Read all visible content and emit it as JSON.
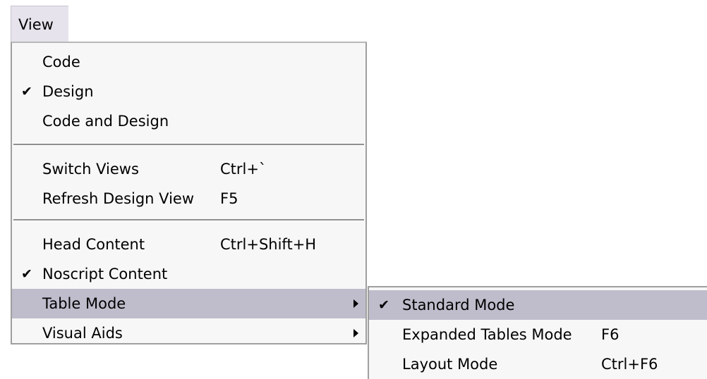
{
  "menubar": {
    "view_label": "View"
  },
  "view_menu": {
    "items": [
      {
        "label": "Code",
        "shortcut": "",
        "checked": false
      },
      {
        "label": "Design",
        "shortcut": "",
        "checked": true
      },
      {
        "label": "Code and Design",
        "shortcut": "",
        "checked": false
      },
      {
        "label": "Switch Views",
        "shortcut": "Ctrl+`",
        "checked": false
      },
      {
        "label": "Refresh Design View",
        "shortcut": "F5",
        "checked": false
      },
      {
        "label": "Head Content",
        "shortcut": "Ctrl+Shift+H",
        "checked": false
      },
      {
        "label": "Noscript Content",
        "shortcut": "",
        "checked": true
      },
      {
        "label": "Table Mode",
        "shortcut": "",
        "checked": false,
        "submenu": true,
        "highlighted": true
      },
      {
        "label": "Visual Aids",
        "shortcut": "",
        "checked": false,
        "submenu": true
      }
    ]
  },
  "table_mode_submenu": {
    "items": [
      {
        "label": "Standard Mode",
        "shortcut": "",
        "checked": true,
        "highlighted": true
      },
      {
        "label": "Expanded Tables Mode",
        "shortcut": "F6",
        "checked": false
      },
      {
        "label": "Layout Mode",
        "shortcut": "Ctrl+F6",
        "checked": false
      }
    ]
  },
  "glyphs": {
    "check": "✔"
  },
  "colors": {
    "menu_background": "#f7f7f7",
    "highlight": "#bfbccb",
    "menubar_active": "#e6e3ec",
    "border": "#9f9f9f"
  }
}
